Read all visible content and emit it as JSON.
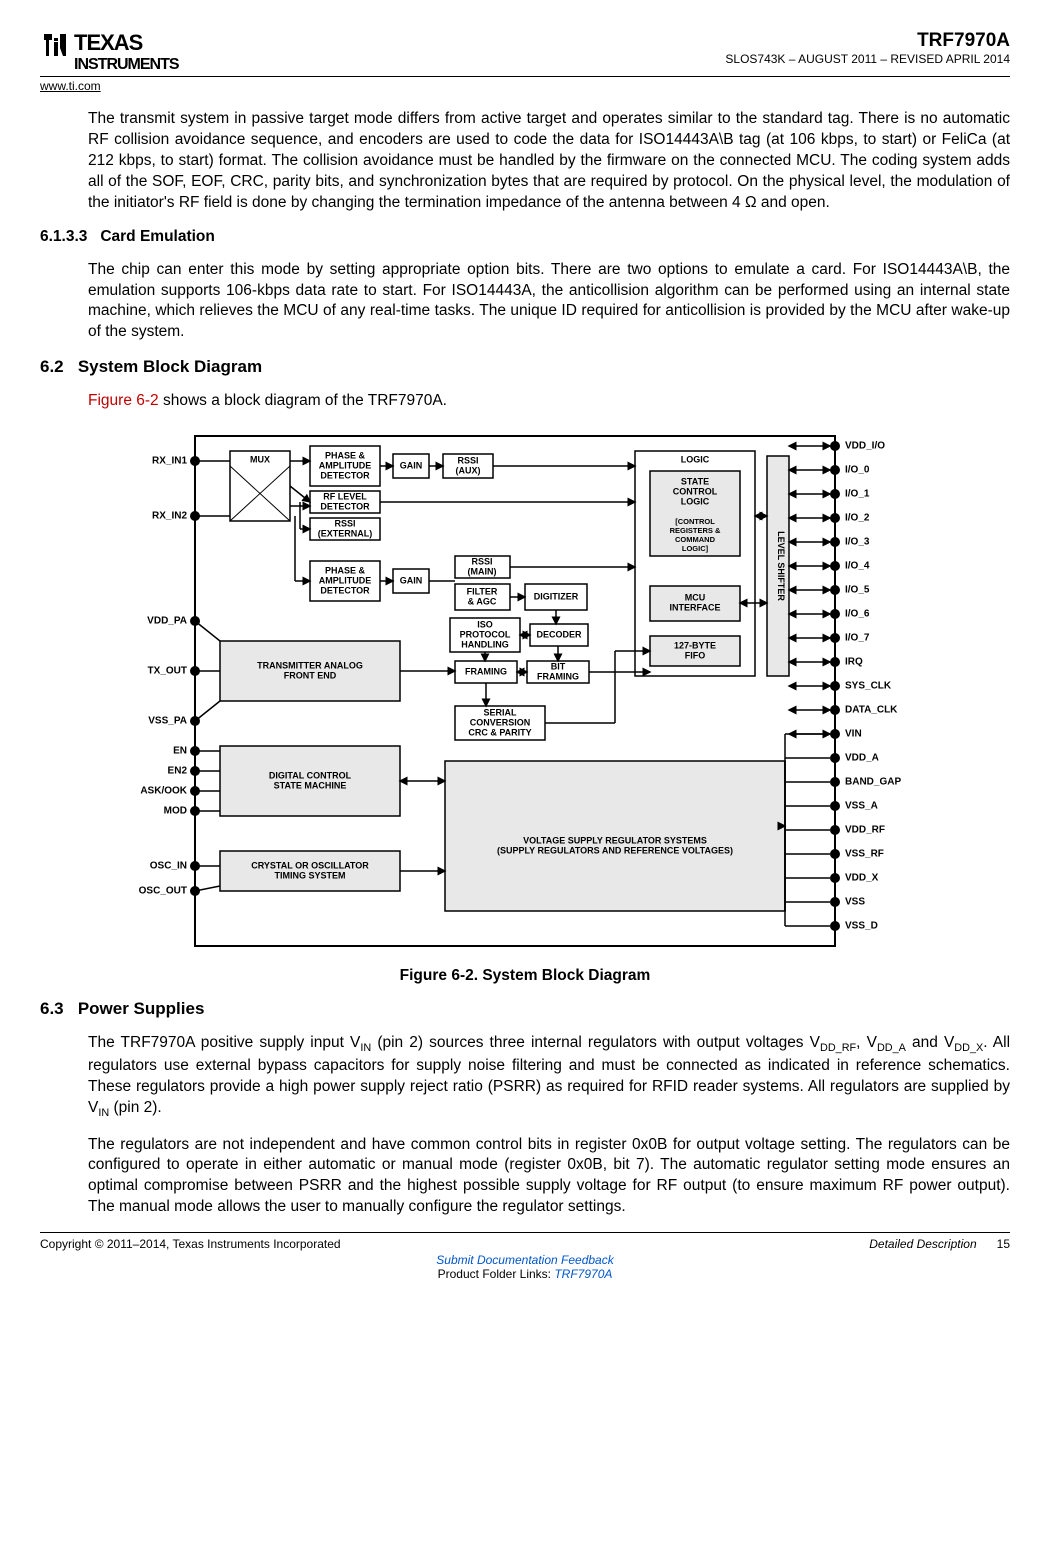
{
  "header": {
    "logo_top": "TEXAS",
    "logo_bottom": "INSTRUMENTS",
    "url": "www.ti.com",
    "part": "TRF7970A",
    "docrev": "SLOS743K – AUGUST 2011 – REVISED APRIL 2014"
  },
  "para_intro": "The transmit system in passive target mode differs from active target and operates similar to the standard tag. There is no automatic RF collision avoidance sequence, and encoders are used to code the data for ISO14443A\\B tag (at 106 kbps, to start) or FeliCa (at 212 kbps, to start) format. The collision avoidance must be handled by the firmware on the connected MCU. The coding system adds all of the SOF, EOF, CRC, parity bits, and synchronization bytes that are required by protocol. On the physical level, the modulation of the initiator's RF field is done by changing the termination impedance of the antenna between 4 Ω and open.",
  "sec6133_num": "6.1.3.3",
  "sec6133_title": "Card Emulation",
  "para6133": "The chip can enter this mode by setting appropriate option bits. There are two options to emulate a card. For ISO14443A\\B, the emulation supports 106-kbps data rate to start. For ISO14443A, the anticollision algorithm can be performed using an internal state machine, which relieves the MCU of any real-time tasks. The unique ID required for anticollision is provided by the MCU after wake-up of the system.",
  "sec62_num": "6.2",
  "sec62_title": "System Block Diagram",
  "fig_ref": "Figure 6-2",
  "fig_intro_tail": " shows a block diagram of the TRF7970A.",
  "fig_caption": "Figure 6-2. System Block Diagram",
  "sec63_num": "6.3",
  "sec63_title": "Power Supplies",
  "para63_html": "The TRF7970A positive supply input V<sub>IN</sub> (pin 2) sources three internal regulators with output voltages V<sub>DD_RF</sub>, V<sub>DD_A</sub> and V<sub>DD_X</sub>. All regulators use external bypass capacitors for supply noise filtering and must be connected as indicated in reference schematics. These regulators provide a high power supply reject ratio (PSRR) as required for RFID reader systems. All regulators are supplied by V<sub>IN</sub> (pin 2).",
  "para63b": "The regulators are not independent and have common control bits in register 0x0B for output voltage setting. The regulators can be configured to operate in either automatic or manual mode (register 0x0B, bit 7). The automatic regulator setting mode ensures an optimal compromise between PSRR and the highest possible supply voltage for RF output (to ensure maximum RF power output). The manual mode allows the user to manually configure the regulator settings.",
  "footer": {
    "copyright": "Copyright © 2011–2014, Texas Instruments Incorporated",
    "section": "Detailed Description",
    "page": "15",
    "feedback": "Submit Documentation Feedback",
    "links_prefix": "Product Folder Links: ",
    "links_product": "TRF7970A"
  },
  "diagram": {
    "left_pins": [
      "RX_IN1",
      "RX_IN2",
      "VDD_PA",
      "TX_OUT",
      "VSS_PA",
      "EN",
      "EN2",
      "ASK/OOK",
      "MOD",
      "OSC_IN",
      "OSC_OUT"
    ],
    "right_pins": [
      "VDD_I/O",
      "I/O_0",
      "I/O_1",
      "I/O_2",
      "I/O_3",
      "I/O_4",
      "I/O_5",
      "I/O_6",
      "I/O_7",
      "IRQ",
      "SYS_CLK",
      "DATA_CLK",
      "VIN",
      "VDD_A",
      "BAND_GAP",
      "VSS_A",
      "VDD_RF",
      "VSS_RF",
      "VDD_X",
      "VSS",
      "VSS_D"
    ],
    "blocks": {
      "mux": "MUX",
      "pad1": "PHASE &\nAMPLITUDE\nDETECTOR",
      "rfl": "RF LEVEL\nDETECTOR",
      "rssi_ext": "RSSI\n(EXTERNAL)",
      "pad2": "PHASE &\nAMPLITUDE\nDETECTOR",
      "gain1": "GAIN",
      "gain2": "GAIN",
      "rssi_aux": "RSSI\n(AUX)",
      "rssi_main": "RSSI\n(MAIN)",
      "filter": "FILTER\n& AGC",
      "digitizer": "DIGITIZER",
      "isoproto": "ISO\nPROTOCOL\nHANDLING",
      "decoder": "DECODER",
      "framing": "FRAMING",
      "bitframing": "BIT\nFRAMING",
      "serial": "SERIAL\nCONVERSION\nCRC & PARITY",
      "logic": "LOGIC",
      "state": "STATE\nCONTROL\nLOGIC",
      "state_sub": "[CONTROL\nREGISTERS &\nCOMMAND\nLOGIC]",
      "mcu": "MCU\nINTERFACE",
      "fifo": "127-BYTE\nFIFO",
      "level": "LEVEL SHIFTER",
      "txafe": "TRANSMITTER ANALOG\nFRONT END",
      "digctrl": "DIGITAL CONTROL\nSTATE MACHINE",
      "crystal": "CRYSTAL OR OSCILLATOR\nTIMING SYSTEM",
      "voltage": "VOLTAGE SUPPLY REGULATOR SYSTEMS\n(SUPPLY REGULATORS AND REFERENCE VOLTAGES)"
    }
  }
}
